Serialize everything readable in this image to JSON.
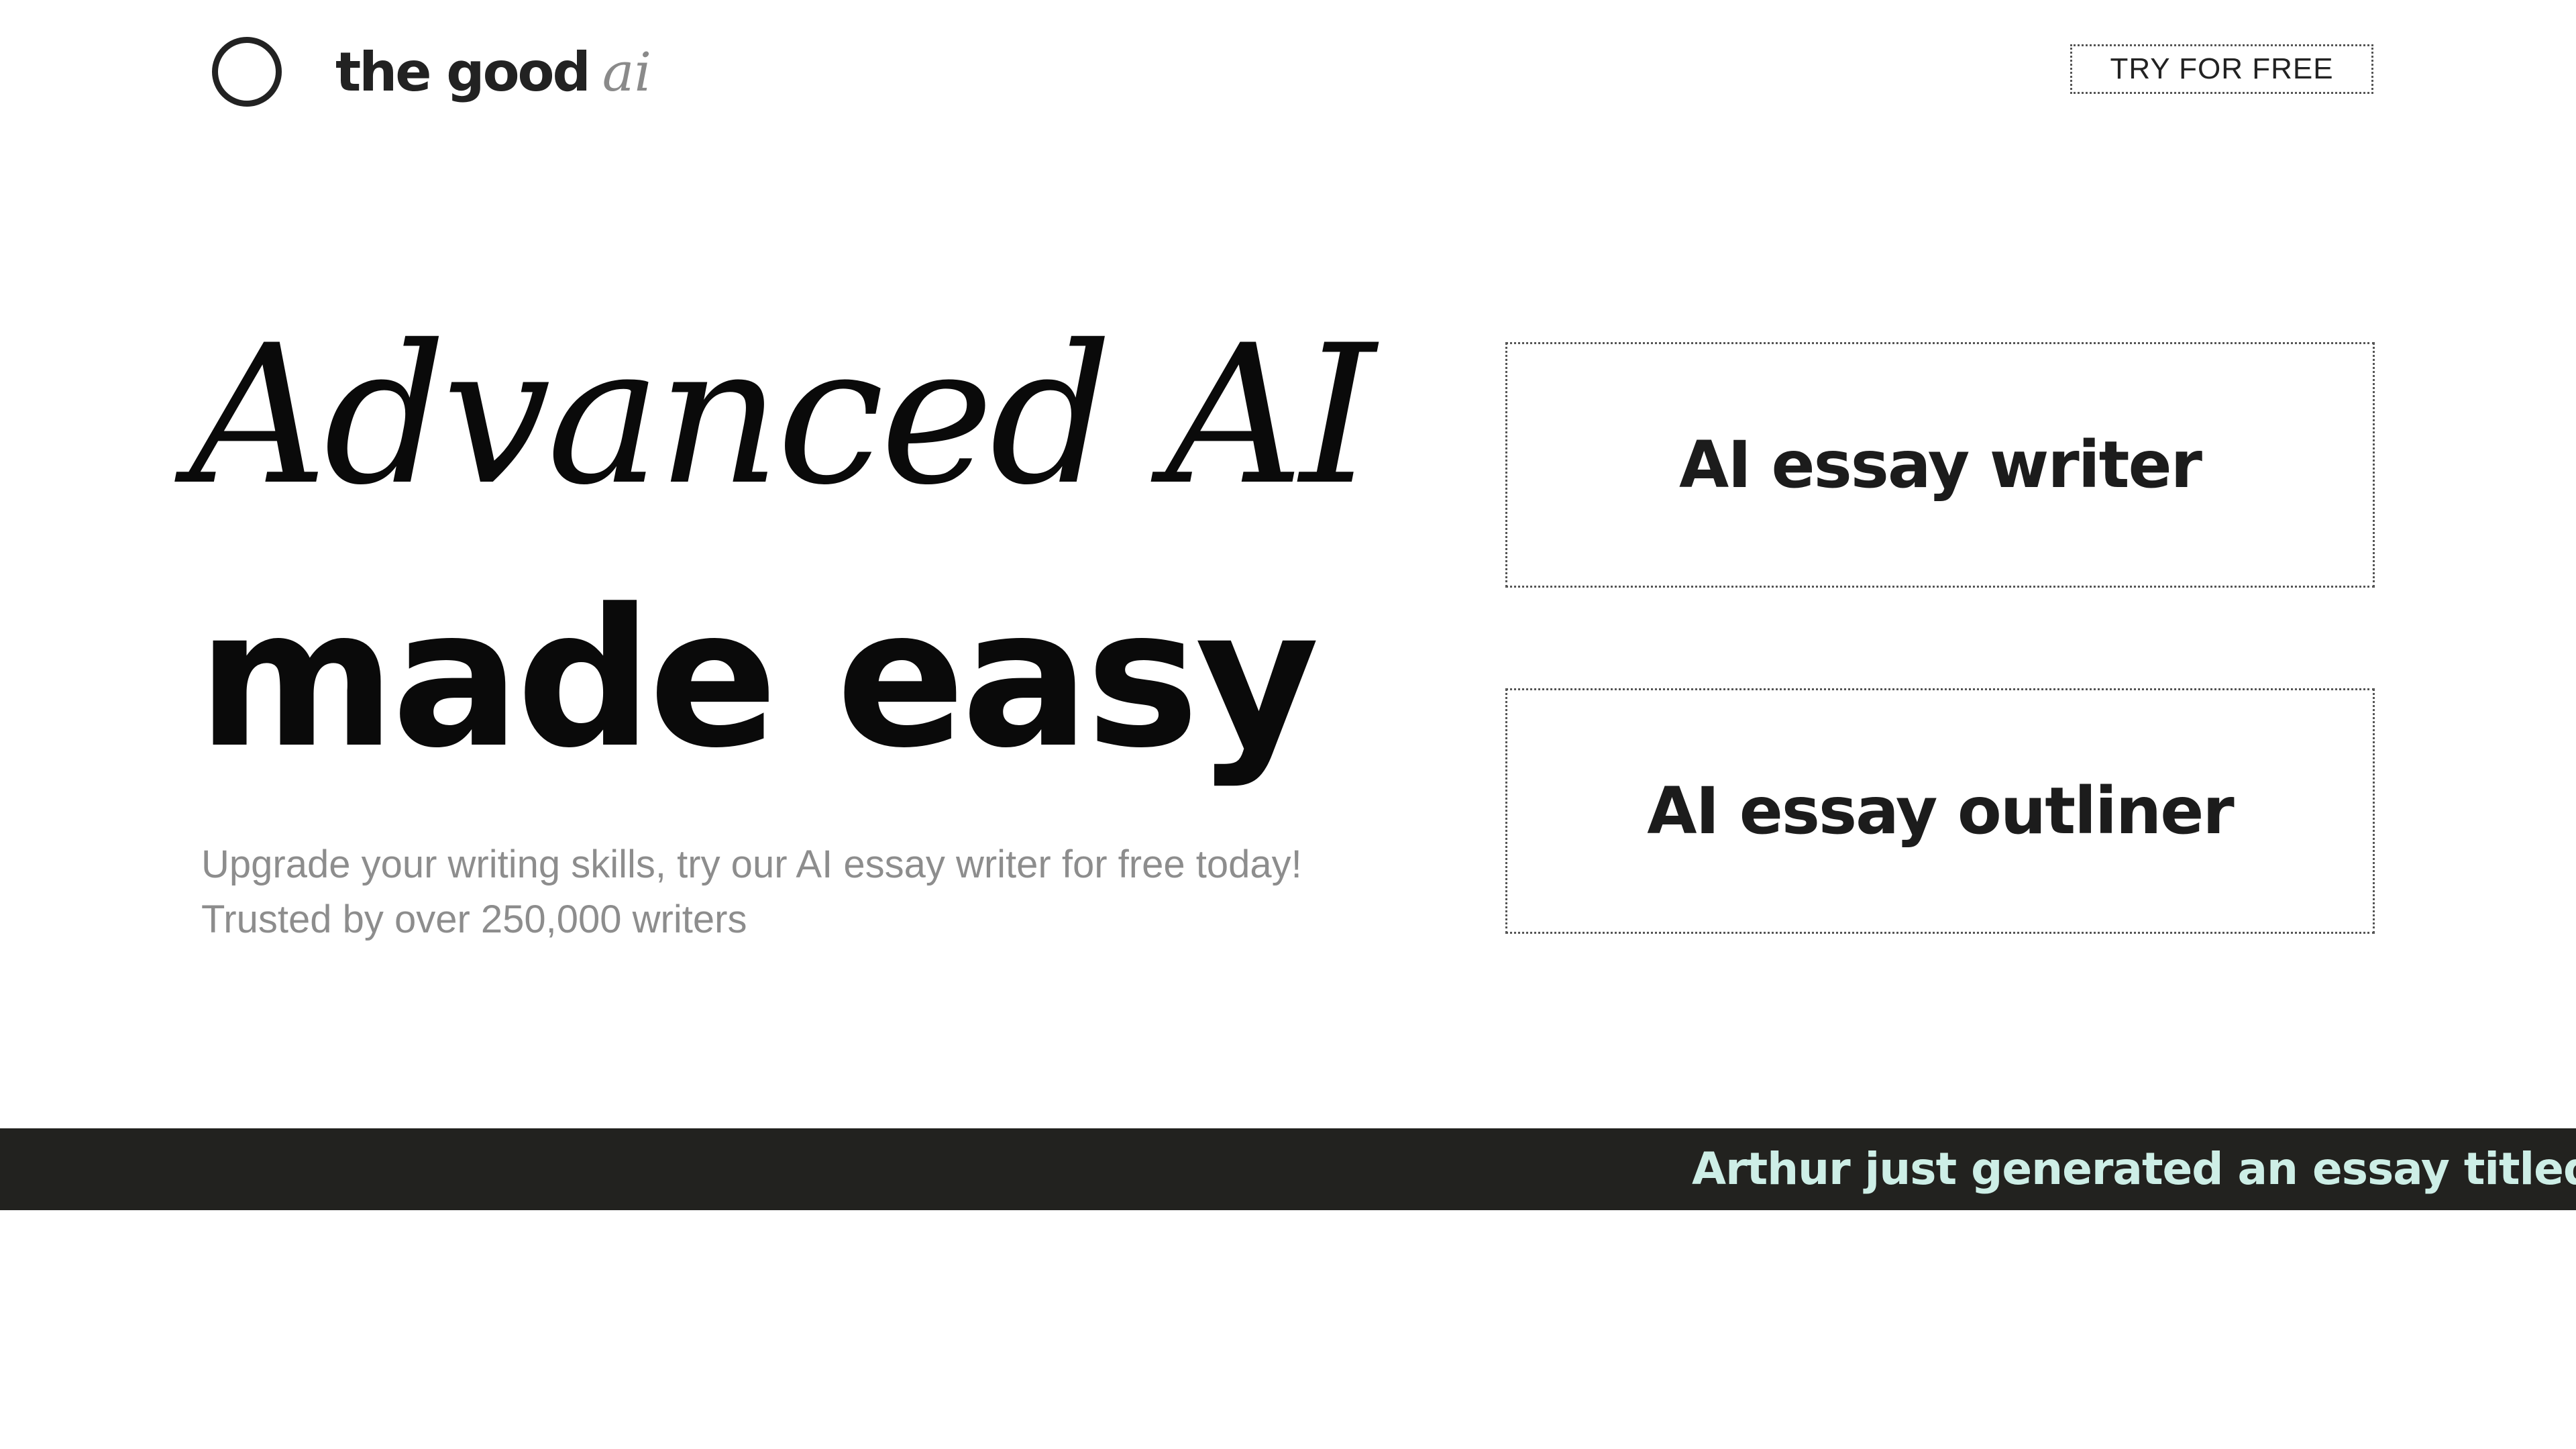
{
  "header": {
    "brand_main": "the good",
    "brand_accent": "ai",
    "logo_icon": "circle-logo-icon",
    "cta_label": "TRY FOR FREE"
  },
  "hero": {
    "line_1": "Advanced AI",
    "line_2": "made easy",
    "subtitle_line_1": "Upgrade your writing skills, try our AI essay writer for free today!",
    "subtitle_line_2": "Trusted by over 250,000 writers"
  },
  "tools": [
    {
      "label": "AI essay writer"
    },
    {
      "label": "AI essay outliner"
    }
  ],
  "ticker": {
    "text": "Arthur just generated an essay titled: \"F"
  },
  "colors": {
    "background": "#ffffff",
    "text_primary": "#0a0a0a",
    "text_muted": "#8d8d8d",
    "brand_accent": "#8a8a8a",
    "ticker_background": "#22221f",
    "ticker_text": "#cdeee6"
  }
}
